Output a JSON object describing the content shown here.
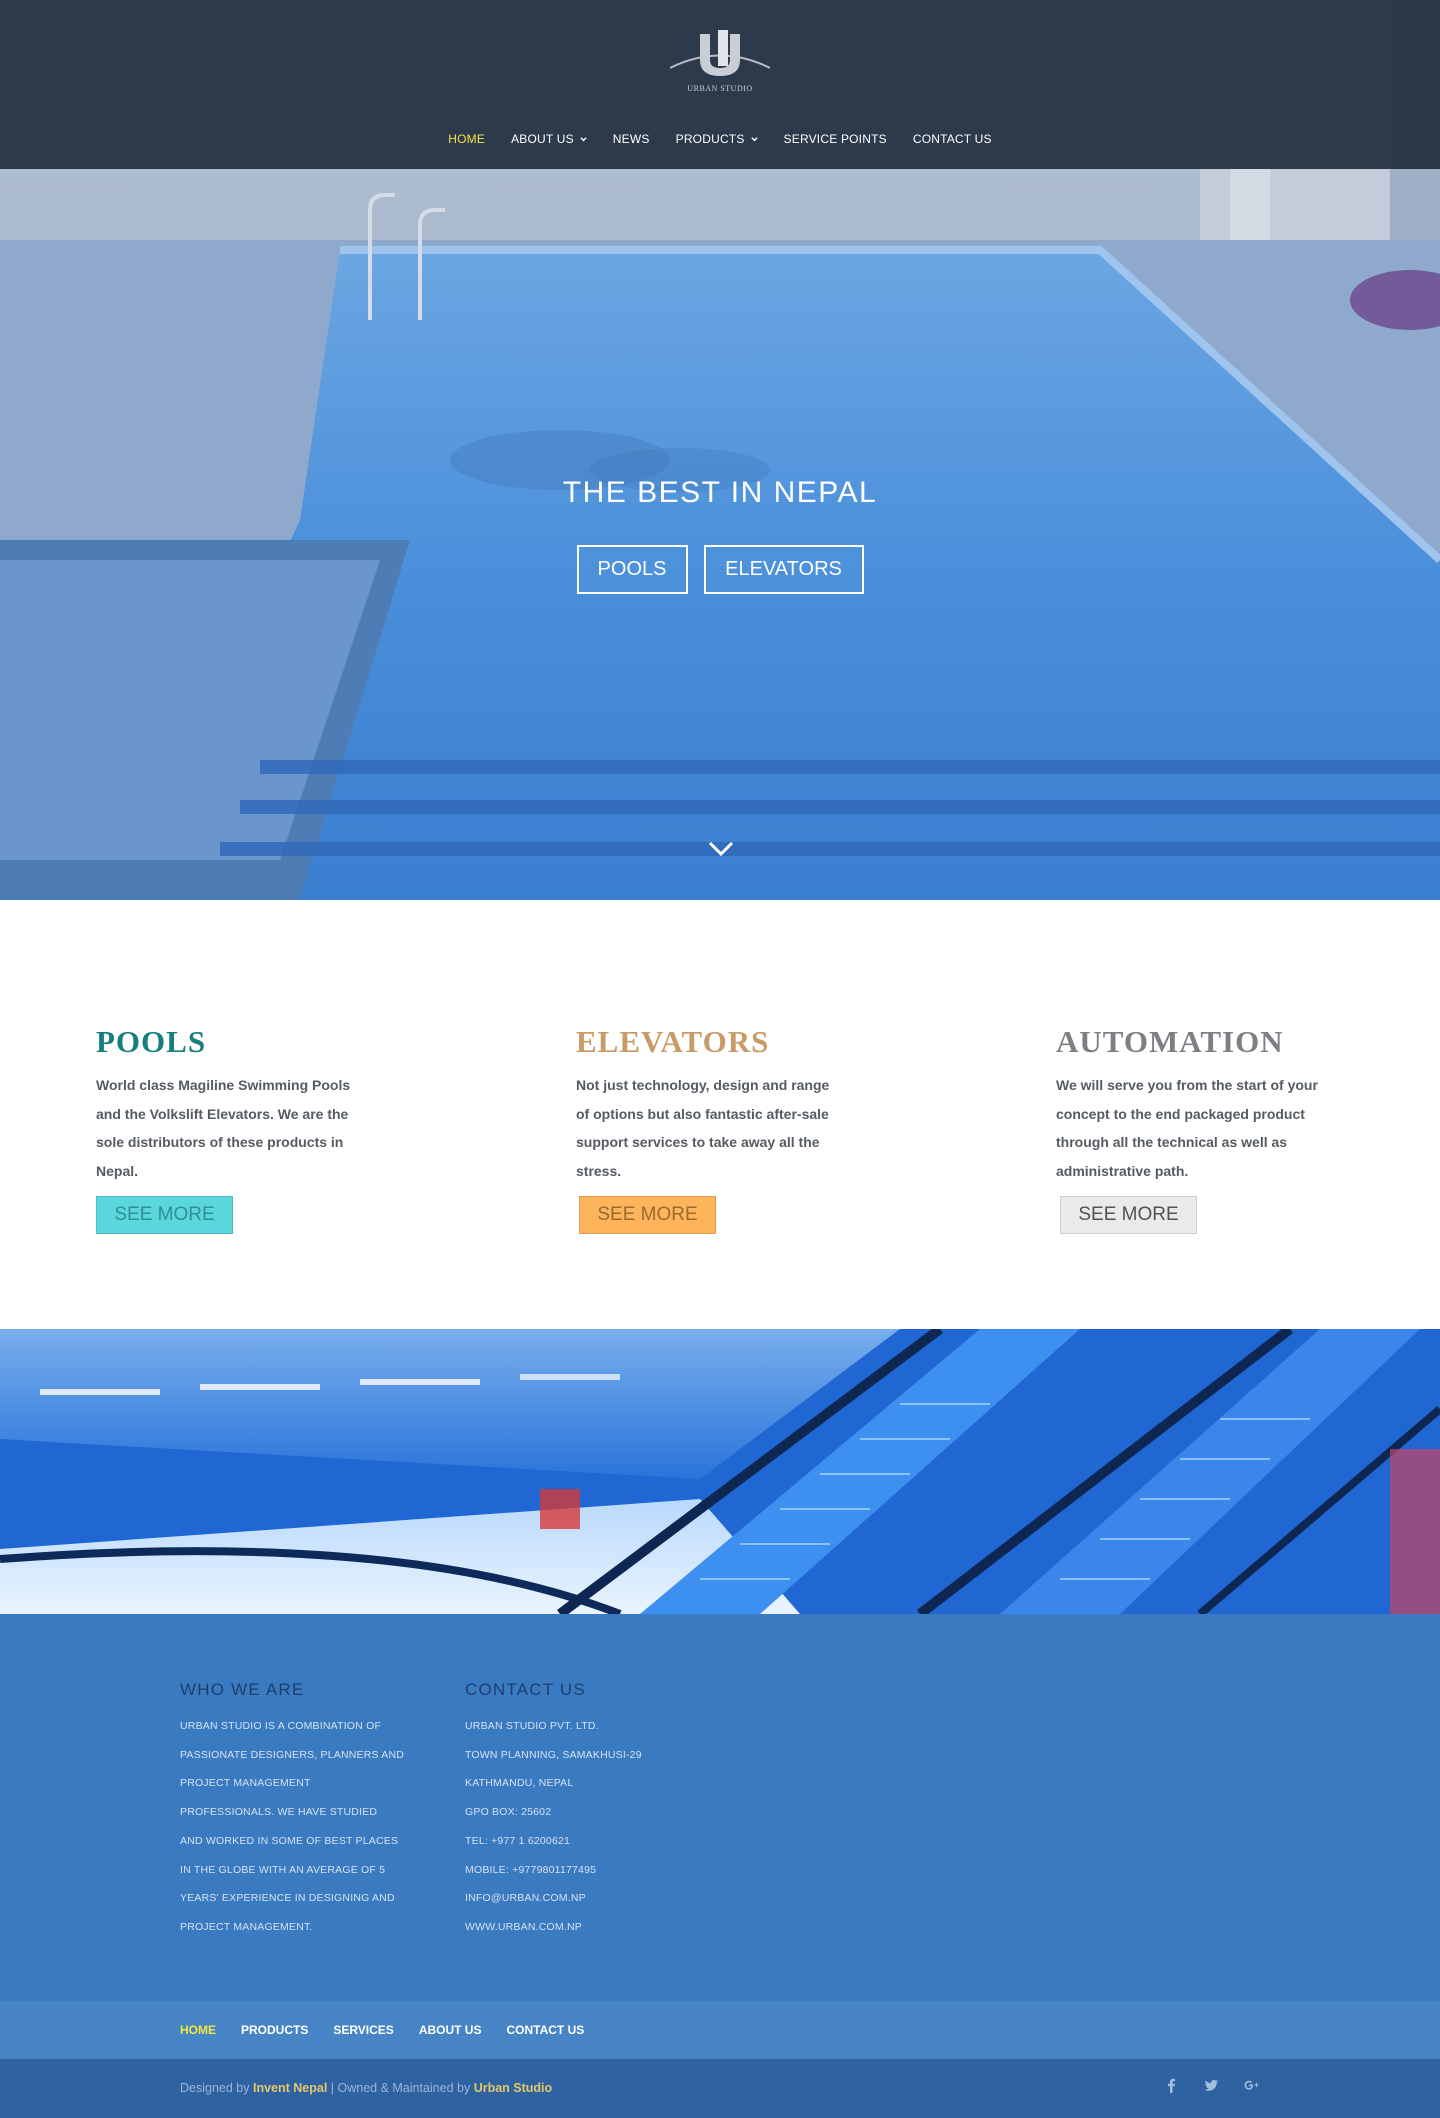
{
  "header": {
    "logo_text": "URBAN STUDIO",
    "nav": [
      {
        "label": "HOME",
        "active": true,
        "dropdown": false
      },
      {
        "label": "ABOUT US",
        "active": false,
        "dropdown": true
      },
      {
        "label": "NEWS",
        "active": false,
        "dropdown": false
      },
      {
        "label": "PRODUCTS",
        "active": false,
        "dropdown": true
      },
      {
        "label": "SERVICE POINTS",
        "active": false,
        "dropdown": false
      },
      {
        "label": "CONTACT US",
        "active": false,
        "dropdown": false
      }
    ]
  },
  "hero": {
    "title": "THE BEST IN NEPAL",
    "button_pools": "POOLS",
    "button_elevators": "ELEVATORS",
    "scroll_icon": "chevron-down-icon"
  },
  "features": [
    {
      "title": "POOLS",
      "text": "World class Magiline Swimming Pools and the Volkslift Elevators. We are the sole distributors of these products in Nepal.",
      "button": "SEE MORE",
      "color": "#167f7d"
    },
    {
      "title": "ELEVATORS",
      "text": "Not just technology, design and range of options but also fantastic after-sale support services to take away all the stress.",
      "button": "SEE MORE",
      "color": "#c89b66"
    },
    {
      "title": "AUTOMATION",
      "text": "We will serve you from the start of your concept to the end packaged product through all the technical as well as administrative path.",
      "button": "SEE MORE",
      "color": "#7d7f84"
    }
  ],
  "footer": {
    "who": {
      "title": "WHO WE ARE",
      "lines": [
        "URBAN STUDIO IS A COMBINATION OF",
        "PASSIONATE DESIGNERS, PLANNERS AND",
        "PROJECT MANAGEMENT",
        "PROFESSIONALS. WE HAVE STUDIED",
        "AND WORKED IN SOME OF BEST PLACES",
        "IN THE GLOBE WITH AN AVERAGE OF 5",
        "YEARS' EXPERIENCE IN DESIGNING AND",
        "PROJECT MANAGEMENT."
      ]
    },
    "contact": {
      "title": "CONTACT US",
      "lines": [
        "URBAN STUDIO PVT. LTD.",
        "TOWN PLANNING, SAMAKHUSI-29",
        "KATHMANDU, NEPAL",
        "GPO BOX: 25602",
        "TEL: +977 1 6200621",
        "MOBILE: +9779801177495",
        "INFO@URBAN.COM.NP",
        "WWW.URBAN.COM.NP"
      ]
    }
  },
  "bottom_nav": [
    {
      "label": "HOME",
      "active": true
    },
    {
      "label": "PRODUCTS",
      "active": false
    },
    {
      "label": "SERVICES",
      "active": false
    },
    {
      "label": "ABOUT US",
      "active": false
    },
    {
      "label": "CONTACT US",
      "active": false
    }
  ],
  "copyright": {
    "designed_by_prefix": "Designed by ",
    "designer": "Invent Nepal",
    "separator": " | Owned & Maintained by ",
    "owner": "Urban Studio"
  },
  "social": [
    "facebook-icon",
    "twitter-icon",
    "google-plus-icon"
  ],
  "colors": {
    "nav_active": "#f2e641",
    "header_bg": "#283446",
    "footer_bg": "#3a7ac1",
    "copyright_bg": "#2e62a0"
  }
}
